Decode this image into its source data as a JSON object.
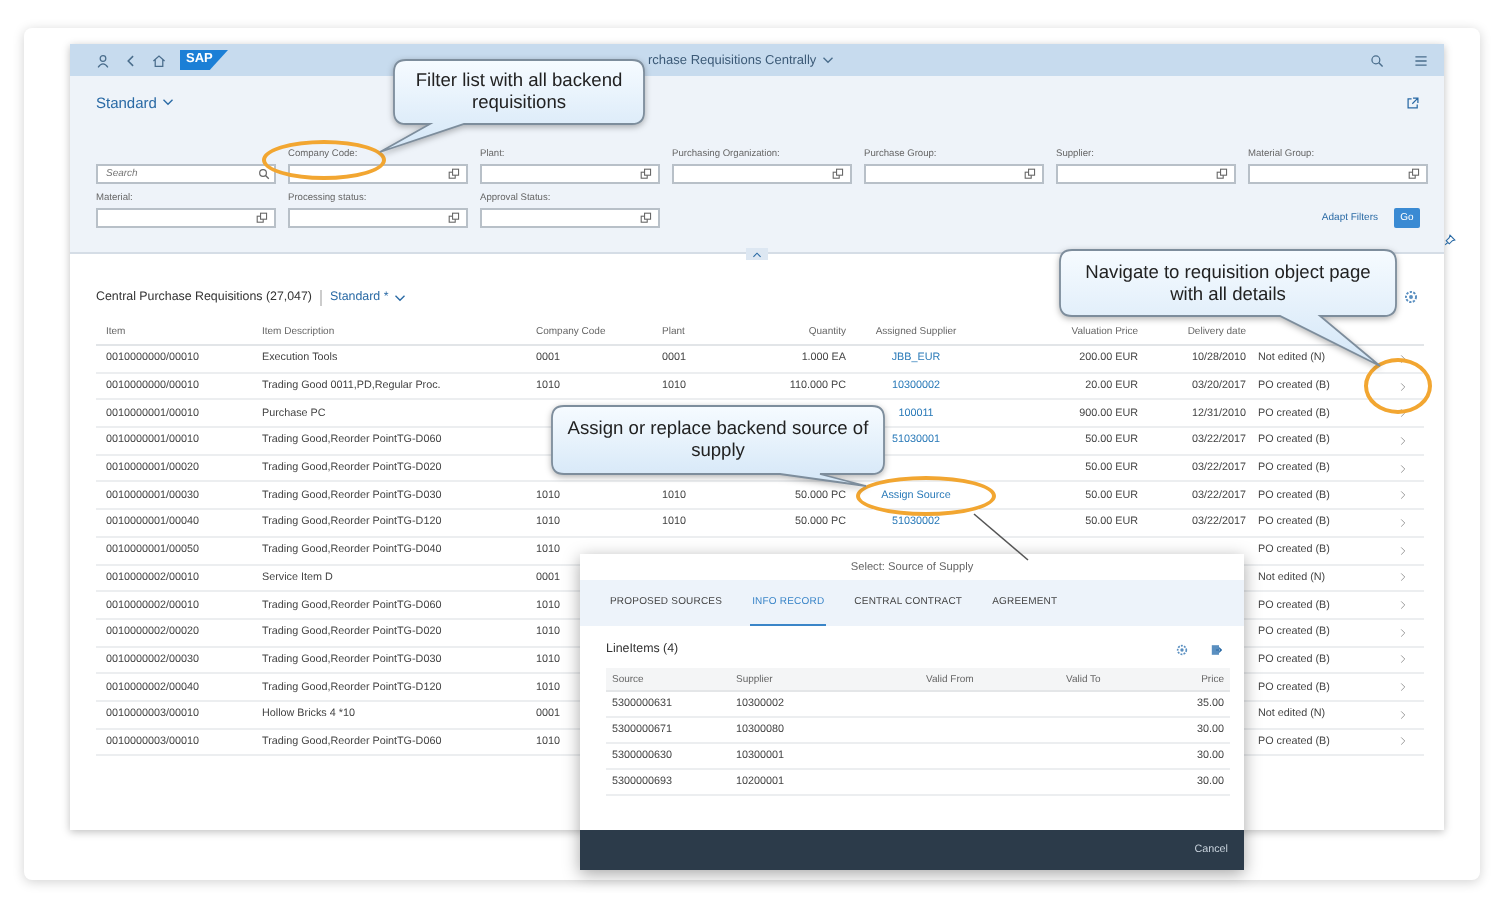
{
  "shell": {
    "logo": "SAP",
    "title": "rchase Requisitions Centrally"
  },
  "filter_bar": {
    "variant": "Standard",
    "filters": [
      {
        "kind": "search",
        "placeholder": "Search"
      },
      {
        "kind": "valuehelp",
        "label": "Company Code:"
      },
      {
        "kind": "valuehelp",
        "label": "Plant:"
      },
      {
        "kind": "valuehelp",
        "label": "Purchasing Organization:"
      },
      {
        "kind": "valuehelp",
        "label": "Purchase Group:"
      },
      {
        "kind": "valuehelp",
        "label": "Supplier:"
      },
      {
        "kind": "valuehelp",
        "label": "Material Group:"
      },
      {
        "kind": "valuehelp",
        "label": "Material:"
      },
      {
        "kind": "valuehelp",
        "label": "Processing status:"
      },
      {
        "kind": "valuehelp",
        "label": "Approval Status:"
      }
    ],
    "adapt_filters": "Adapt Filters",
    "go": "Go"
  },
  "table": {
    "title": "Central Purchase Requisitions (27,047)",
    "variant": "Standard *",
    "columns": [
      "Item",
      "Item Description",
      "Company Code",
      "Plant",
      "Quantity",
      "Assigned Supplier",
      "Valuation Price",
      "Delivery date"
    ],
    "rows": [
      {
        "item": "0010000000/00010",
        "description": "Execution Tools",
        "company_code": "0001",
        "plant": "0001",
        "quantity": "1.000 EA",
        "supplier": "JBB_EUR",
        "price": "200.00 EUR",
        "delivery_date": "10/28/2010",
        "status": "Not edited (N)"
      },
      {
        "item": "0010000000/00010",
        "description": "Trading Good 0011,PD,Regular Proc.",
        "company_code": "1010",
        "plant": "1010",
        "quantity": "110.000 PC",
        "supplier": "10300002",
        "price": "20.00 EUR",
        "delivery_date": "03/20/2017",
        "status": "PO created (B)"
      },
      {
        "item": "0010000001/00010",
        "description": "Purchase PC",
        "supplier": "100011",
        "price": "900.00 EUR",
        "delivery_date": "12/31/2010",
        "status": "PO created (B)"
      },
      {
        "item": "0010000001/00010",
        "description": "Trading Good,Reorder PointTG-D060",
        "supplier": "51030001",
        "price": "50.00 EUR",
        "delivery_date": "03/22/2017",
        "status": "PO created (B)"
      },
      {
        "item": "0010000001/00020",
        "description": "Trading Good,Reorder PointTG-D020",
        "price": "50.00 EUR",
        "delivery_date": "03/22/2017",
        "status": "PO created (B)"
      },
      {
        "item": "0010000001/00030",
        "description": "Trading Good,Reorder PointTG-D030",
        "company_code": "1010",
        "plant": "1010",
        "quantity": "50.000 PC",
        "supplier": "Assign Source",
        "price": "50.00 EUR",
        "delivery_date": "03/22/2017",
        "status": "PO created (B)"
      },
      {
        "item": "0010000001/00040",
        "description": "Trading Good,Reorder PointTG-D120",
        "company_code": "1010",
        "plant": "1010",
        "quantity": "50.000 PC",
        "supplier": "51030002",
        "price": "50.00 EUR",
        "delivery_date": "03/22/2017",
        "status": "PO created (B)"
      },
      {
        "item": "0010000001/00050",
        "description": "Trading Good,Reorder PointTG-D040",
        "company_code": "1010",
        "status": "PO created (B)"
      },
      {
        "item": "0010000002/00010",
        "description": "Service Item D",
        "company_code": "0001",
        "status": "Not edited (N)"
      },
      {
        "item": "0010000002/00010",
        "description": "Trading Good,Reorder PointTG-D060",
        "company_code": "1010",
        "status": "PO created (B)"
      },
      {
        "item": "0010000002/00020",
        "description": "Trading Good,Reorder PointTG-D020",
        "company_code": "1010",
        "status": "PO created (B)"
      },
      {
        "item": "0010000002/00030",
        "description": "Trading Good,Reorder PointTG-D030",
        "company_code": "1010",
        "status": "PO created (B)"
      },
      {
        "item": "0010000002/00040",
        "description": "Trading Good,Reorder PointTG-D120",
        "company_code": "1010",
        "status": "PO created (B)"
      },
      {
        "item": "0010000003/00010",
        "description": "Hollow Bricks 4 *10",
        "company_code": "0001",
        "status": "Not edited (N)"
      },
      {
        "item": "0010000003/00010",
        "description": "Trading Good,Reorder PointTG-D060",
        "company_code": "1010",
        "status": "PO created (B)"
      }
    ]
  },
  "dialog": {
    "title": "Select: Source of Supply",
    "tabs": [
      {
        "label": "PROPOSED SOURCES",
        "selected": false
      },
      {
        "label": "INFO RECORD",
        "selected": true
      },
      {
        "label": "CENTRAL CONTRACT",
        "selected": false
      },
      {
        "label": "AGREEMENT",
        "selected": false
      }
    ],
    "list_title": "LineItems (4)",
    "columns": [
      "Source",
      "Supplier",
      "Valid From",
      "Valid To",
      "Price"
    ],
    "rows": [
      {
        "source": "5300000631",
        "supplier": "10300002",
        "price": "35.00"
      },
      {
        "source": "5300000671",
        "supplier": "10300080",
        "price": "30.00"
      },
      {
        "source": "5300000630",
        "supplier": "10300001",
        "price": "30.00"
      },
      {
        "source": "5300000693",
        "supplier": "10200001",
        "price": "30.00"
      }
    ],
    "cancel": "Cancel"
  },
  "callouts": [
    {
      "text": "Filter list with all backend requisitions"
    },
    {
      "text": "Navigate to requisition object page with all details"
    },
    {
      "text": "Assign or replace backend source of supply"
    }
  ]
}
